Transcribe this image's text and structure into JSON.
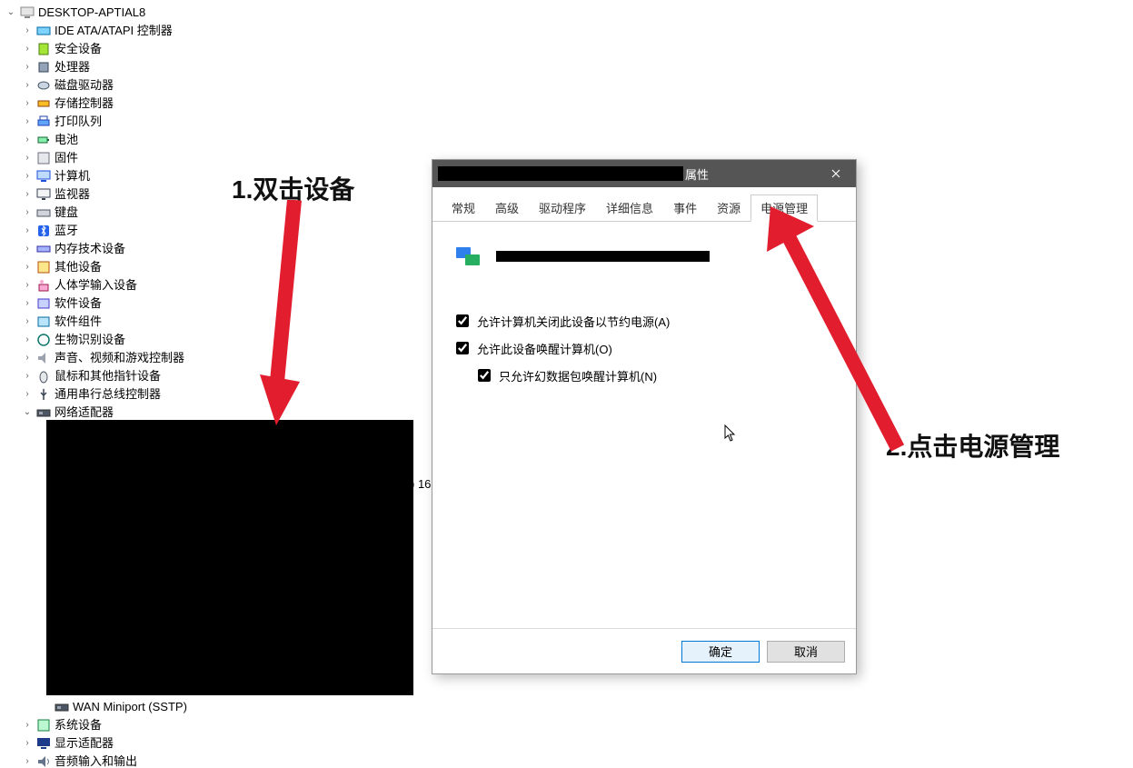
{
  "root": {
    "name": "DESKTOP-APTIAL8"
  },
  "categories": [
    {
      "label": "IDE ATA/ATAPI 控制器",
      "icon": "ide"
    },
    {
      "label": "安全设备",
      "icon": "security"
    },
    {
      "label": "处理器",
      "icon": "cpu"
    },
    {
      "label": "磁盘驱动器",
      "icon": "disk"
    },
    {
      "label": "存储控制器",
      "icon": "storage"
    },
    {
      "label": "打印队列",
      "icon": "printer"
    },
    {
      "label": "电池",
      "icon": "battery"
    },
    {
      "label": "固件",
      "icon": "firmware"
    },
    {
      "label": "计算机",
      "icon": "computer"
    },
    {
      "label": "监视器",
      "icon": "monitor"
    },
    {
      "label": "键盘",
      "icon": "keyboard"
    },
    {
      "label": "蓝牙",
      "icon": "bluetooth"
    },
    {
      "label": "内存技术设备",
      "icon": "memory"
    },
    {
      "label": "其他设备",
      "icon": "other"
    },
    {
      "label": "人体学输入设备",
      "icon": "hid"
    },
    {
      "label": "软件设备",
      "icon": "software"
    },
    {
      "label": "软件组件",
      "icon": "component"
    },
    {
      "label": "生物识别设备",
      "icon": "biometric"
    },
    {
      "label": "声音、视频和游戏控制器",
      "icon": "sound"
    },
    {
      "label": "鼠标和其他指针设备",
      "icon": "mouse"
    },
    {
      "label": "通用串行总线控制器",
      "icon": "usb"
    }
  ],
  "netAdapterCategory": "网络适配器",
  "netChild": "WAN Miniport (SSTP)",
  "tailCategories": [
    {
      "label": "系统设备",
      "icon": "system"
    },
    {
      "label": "显示适配器",
      "icon": "display"
    },
    {
      "label": "音频输入和输出",
      "icon": "audio"
    }
  ],
  "behindFragment": ") 16",
  "dialog": {
    "titleSuffix": "属性",
    "tabs": [
      "常规",
      "高级",
      "驱动程序",
      "详细信息",
      "事件",
      "资源",
      "电源管理"
    ],
    "activeTab": 6,
    "option1": "允许计算机关闭此设备以节约电源(A)",
    "option2": "允许此设备唤醒计算机(O)",
    "option3": "只允许幻数据包唤醒计算机(N)",
    "ok": "确定",
    "cancel": "取消"
  },
  "annotations": {
    "step1": "1.双击设备",
    "step2": "2.点击电源管理"
  }
}
